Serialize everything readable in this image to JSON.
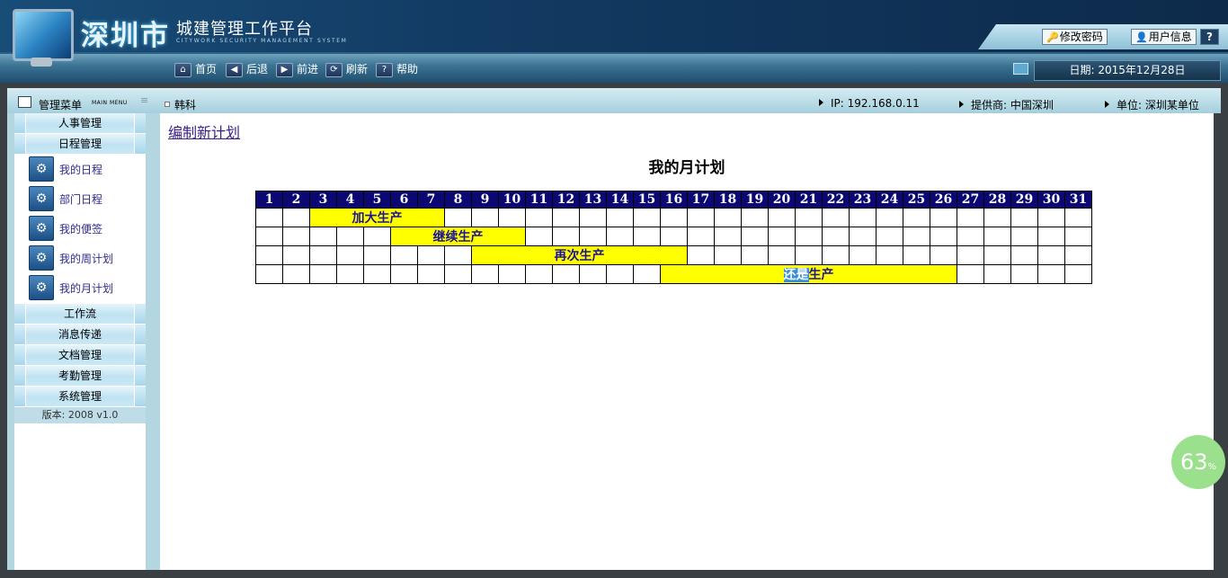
{
  "header": {
    "logo_main": "深圳市",
    "logo_sub": "城建管理工作平台",
    "logo_en": "CITYWORK SECURITY MANAGEMENT SYSTEM",
    "buttons": [
      {
        "label": "修改密码",
        "glyph": "🔑"
      },
      {
        "label": "用户信息",
        "glyph": "👤"
      },
      {
        "label": "?",
        "glyph": ""
      }
    ],
    "nav": [
      {
        "label": "首页",
        "icon": "home-icon",
        "glyph": "⌂"
      },
      {
        "label": "后退",
        "icon": "back-icon",
        "glyph": "◀"
      },
      {
        "label": "前进",
        "icon": "forward-icon",
        "glyph": "▶"
      },
      {
        "label": "刷新",
        "icon": "refresh-icon",
        "glyph": "⟳"
      },
      {
        "label": "帮助",
        "icon": "help-icon",
        "glyph": "?"
      }
    ],
    "date": "日期: 2015年12月28日"
  },
  "sidebar": {
    "title": "管理菜单",
    "title_en": "MAIN MENU",
    "groups_top": [
      {
        "label": "人事管理"
      },
      {
        "label": "日程管理"
      }
    ],
    "items": [
      {
        "label": "我的日程"
      },
      {
        "label": "部门日程"
      },
      {
        "label": "我的便签"
      },
      {
        "label": "我的周计划"
      },
      {
        "label": "我的月计划"
      }
    ],
    "groups_bottom": [
      {
        "label": "工作流"
      },
      {
        "label": "消息传递"
      },
      {
        "label": "文档管理"
      },
      {
        "label": "考勤管理"
      },
      {
        "label": "系统管理"
      }
    ],
    "version": "版本: 2008 v1.0"
  },
  "status": {
    "user": "韩科",
    "ip": "IP: 192.168.0.11",
    "provider": "提供商: 中国深圳",
    "unit": "单位: 深圳某单位"
  },
  "main": {
    "new_plan_link": "编制新计划",
    "title": "我的月计划",
    "days": 31,
    "rows": [
      {
        "label": "加大生产",
        "start": 3,
        "end": 7
      },
      {
        "label": "继续生产",
        "start": 6,
        "end": 10
      },
      {
        "label": "再次生产",
        "start": 9,
        "end": 16
      },
      {
        "label_hl": "还是",
        "label_rest": "生产",
        "start": 16,
        "end": 26
      }
    ]
  },
  "badge": {
    "value": "63",
    "unit": "%"
  },
  "colors": {
    "header_dark": "#0f2a4c",
    "calendar_head": "#0b0873",
    "event_fill": "#ffff00",
    "event_text": "#1b149a"
  }
}
